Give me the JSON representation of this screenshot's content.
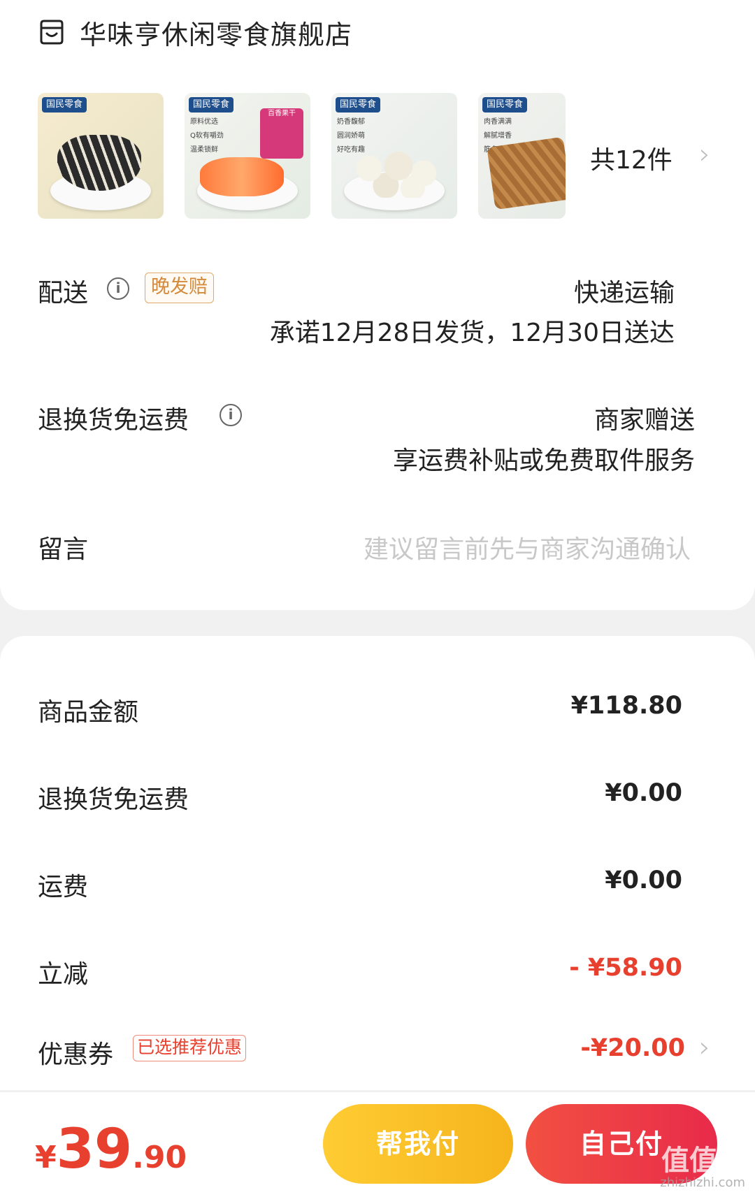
{
  "store": {
    "name": "华味亨休闲零食旗舰店",
    "icon": "store-icon"
  },
  "products": {
    "thumbs": [
      {
        "brand": "国民零食",
        "tags": []
      },
      {
        "brand": "国民零食",
        "tags": [
          "原料优选",
          "Q软有嚼劲",
          "温柔锁鲜"
        ],
        "pack_label": "百香果干"
      },
      {
        "brand": "国民零食",
        "tags": [
          "奶香馥郁",
          "圆润娇萌",
          "好吃有趣"
        ]
      },
      {
        "brand": "国民零食",
        "tags": [
          "肉香满满",
          "解腻增香",
          "筋多肉软"
        ]
      }
    ],
    "count_label": "共12件"
  },
  "delivery": {
    "label": "配送",
    "tag": "晚发赔",
    "method": "快递运输",
    "promise": "承诺12月28日发货，12月30日送达"
  },
  "return_shipping": {
    "label": "退换货免运费",
    "value": "商家赠送",
    "desc": "享运费补贴或免费取件服务"
  },
  "message": {
    "label": "留言",
    "placeholder": "建议留言前先与商家沟通确认"
  },
  "summary": {
    "goods_label": "商品金额",
    "goods_value": "¥118.80",
    "return_label": "退换货免运费",
    "return_value": "¥0.00",
    "shipping_label": "运费",
    "shipping_value": "¥0.00",
    "discount_label": "立减",
    "discount_value": "- ¥58.90",
    "coupon_label": "优惠券",
    "coupon_tag": "已选推荐优惠",
    "coupon_value": "-¥20.00"
  },
  "footer": {
    "currency": "¥",
    "total_int": "39",
    "total_dec": ".90",
    "help_pay": "帮我付",
    "self_pay": "自己付",
    "watermark": "值值值",
    "watermark_sub": "zhizhizhi.com"
  },
  "colors": {
    "accent_red": "#e8402e",
    "button_yellow": "#f6b41c",
    "button_red": "#e82a4a",
    "tag_orange": "#d48a3a"
  }
}
